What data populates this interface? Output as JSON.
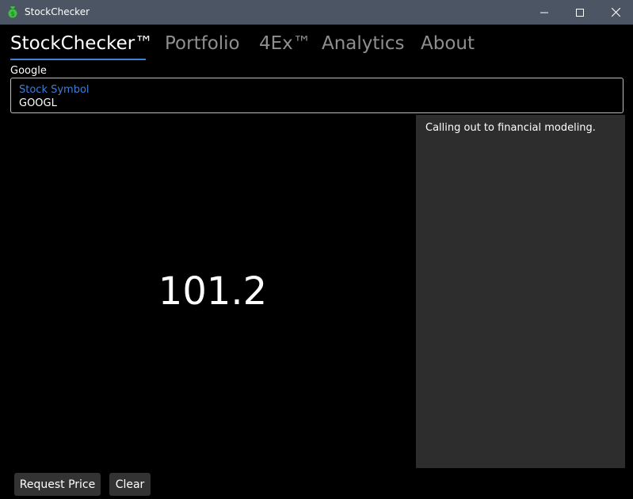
{
  "window": {
    "title": "StockChecker"
  },
  "nav": {
    "tabs": [
      {
        "label": "StockChecker™"
      },
      {
        "label": "Portfolio"
      },
      {
        "label": "4Ex™"
      },
      {
        "label": "Analytics"
      },
      {
        "label": "About"
      }
    ],
    "active_index": 0
  },
  "company": {
    "name": "Google"
  },
  "symbol_field": {
    "label": "Stock Symbol",
    "value": "GOOGL"
  },
  "price": {
    "value": "101.2"
  },
  "log": {
    "message": "Calling out to financial modeling."
  },
  "actions": {
    "request_label": "Request Price",
    "clear_label": "Clear"
  },
  "colors": {
    "accent": "#3b82d8",
    "titlebar": "#4b5563",
    "panel": "#2d2d2d",
    "button": "#333333"
  },
  "icons": {
    "app": "money-bag-icon",
    "minimize": "minimize-icon",
    "maximize": "maximize-icon",
    "close": "close-icon"
  }
}
